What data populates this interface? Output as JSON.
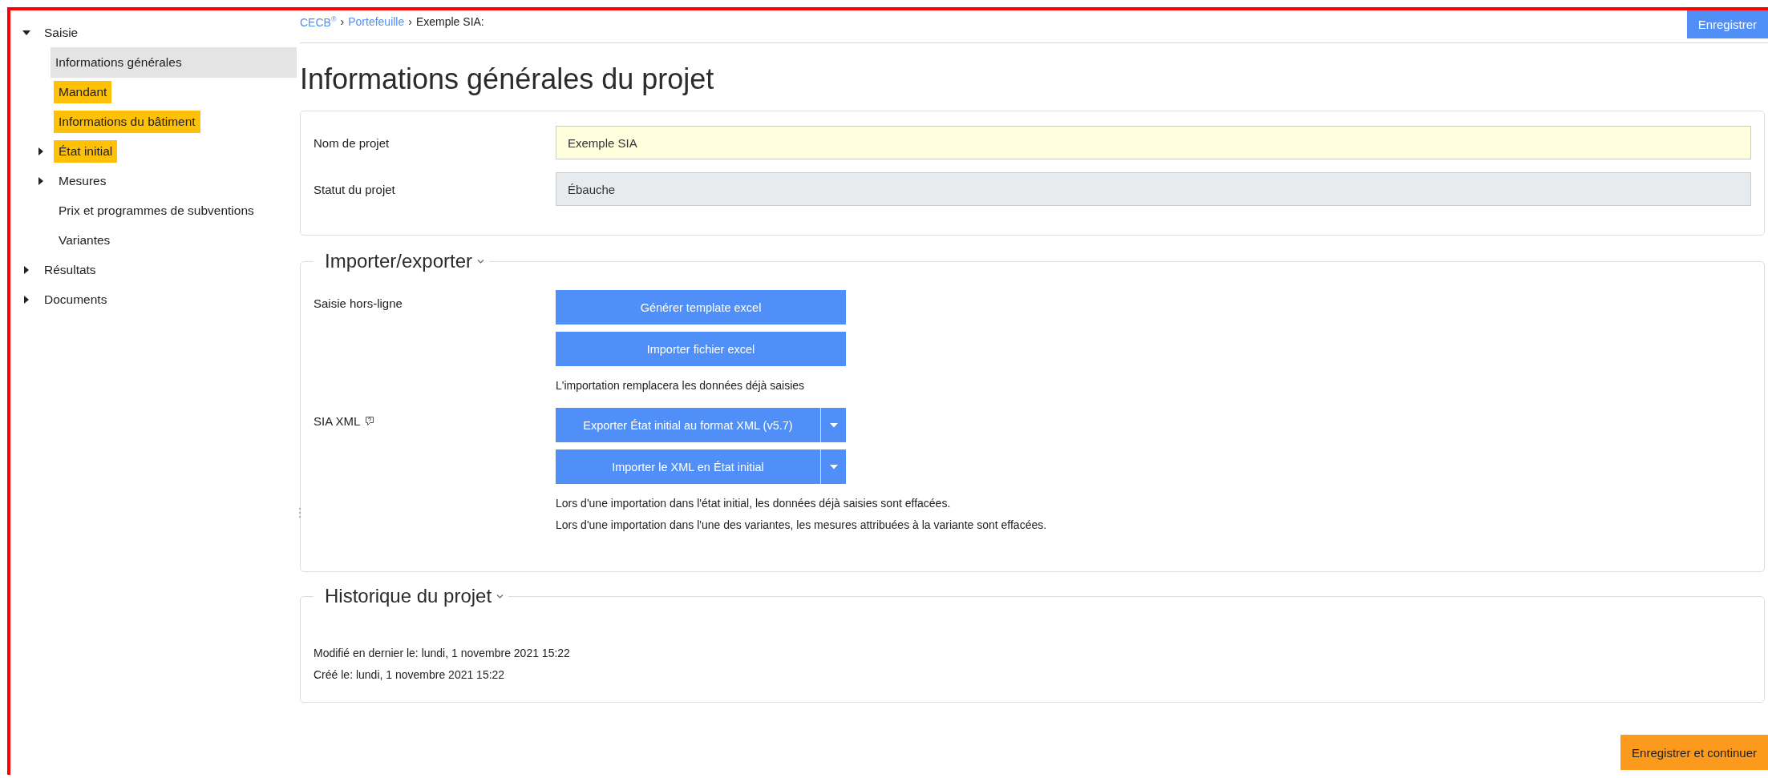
{
  "sidebar": {
    "items": [
      {
        "label": "Saisie",
        "expanded": true,
        "selected": false,
        "flagged": false,
        "children": [
          {
            "label": "Informations générales",
            "selected": true,
            "flagged": false
          },
          {
            "label": "Mandant",
            "selected": false,
            "flagged": true
          },
          {
            "label": "Informations du bâtiment",
            "selected": false,
            "flagged": true
          },
          {
            "label": "État initial",
            "expanded": false,
            "selected": false,
            "flagged": true
          },
          {
            "label": "Mesures",
            "expanded": false,
            "selected": false,
            "flagged": false
          },
          {
            "label": "Prix et programmes de subventions",
            "selected": false,
            "flagged": false
          },
          {
            "label": "Variantes",
            "selected": false,
            "flagged": false
          }
        ]
      },
      {
        "label": "Résultats",
        "expanded": false,
        "selected": false,
        "flagged": false
      },
      {
        "label": "Documents",
        "expanded": false,
        "selected": false,
        "flagged": false
      }
    ]
  },
  "breadcrumb": [
    {
      "text": "CECB$^{®}$",
      "kind": "link"
    },
    {
      "text": "›",
      "kind": "separator"
    },
    {
      "text": "Portefeuille",
      "kind": "link"
    },
    {
      "text": "›",
      "kind": "separator"
    },
    {
      "text": "Exemple SIA:",
      "kind": "current"
    }
  ],
  "save_button": "Enregistrer",
  "title": "Informations générales du projet",
  "fields": [
    {
      "label": "Nom de projet",
      "value": "Exemple SIA",
      "kind": "input"
    },
    {
      "label": "Statut du projet",
      "value": "Ébauche",
      "kind": "readonly"
    }
  ],
  "import_export": {
    "title": "Importer/exporter",
    "expanded": true,
    "rows": [
      {
        "label": "Saisie hors-ligne",
        "help": false,
        "buttons": [
          {
            "label": "Générer template excel",
            "split": false
          },
          {
            "label": "Importer fichier excel",
            "split": false
          }
        ],
        "notes": [
          "L'importation remplacera les données déjà saisies"
        ]
      },
      {
        "label": "SIA XML",
        "help": true,
        "buttons": [
          {
            "label": "Exporter État initial au format XML (v5.7)",
            "split": true
          },
          {
            "label": "Importer le XML en État initial",
            "split": true
          }
        ],
        "notes": [
          "Lors d'une importation dans l'état initial, les données déjà saisies sont effacées.",
          "Lors d'une importation dans l'une des variantes, les mesures attribuées à la variante sont effacées."
        ]
      }
    ]
  },
  "history": {
    "title": "Historique du projet",
    "expanded": true,
    "lines": [
      "Modifié en dernier le: lundi, 1 novembre 2021 15:22",
      "Créé le: lundi, 1 novembre 2021 15:22"
    ]
  },
  "continue_button": "Enregistrer et continuer"
}
